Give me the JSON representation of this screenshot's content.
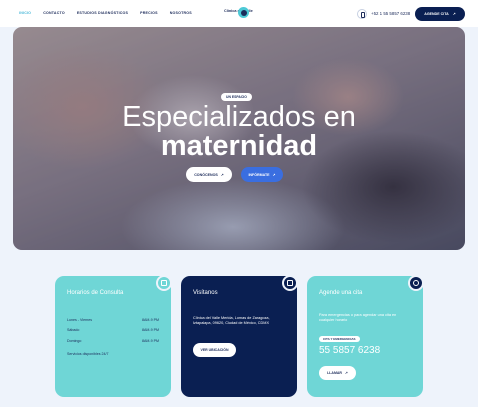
{
  "nav": {
    "links": [
      "INICIO",
      "CONTACTO",
      "ESTUDIOS DIAGNÓSTICOS",
      "PRECIOS",
      "NOSOTROS"
    ],
    "logo_text": "Clínica del Valle",
    "phone": "+52 1 55 5857 6238",
    "cta_label": "AGENDE CITA",
    "cta_icon": "arrow-up-right-icon"
  },
  "hero": {
    "badge": "UN ESPACIO",
    "title_line1": "Especializados en",
    "title_line2": "maternidad",
    "button_primary": "CONÓCENOS",
    "button_secondary": "INFÓRMATE",
    "button_icon": "arrow-up-right-icon"
  },
  "cards": {
    "schedule": {
      "title": "Horarios de Consulta",
      "icon": "calendar-icon",
      "rows": [
        {
          "day": "Lunes - Viernes",
          "hours": "8AM-9 PM"
        },
        {
          "day": "Sábado",
          "hours": "8AM-9 PM"
        },
        {
          "day": "Domingo",
          "hours": "8AM-9 PM"
        }
      ],
      "note": "Servicios disponibles 24/7"
    },
    "visit": {
      "title": "Visítanos",
      "icon": "map-icon",
      "address": "Clínica del Valle Merida, Lomas de Zaragoza, Iztapalapa, 09620, Ciudad de México, CDMX",
      "button": "VER UBICACIÓN"
    },
    "appointment": {
      "title": "Agende una cita",
      "icon": "user-icon",
      "text": "Para emergencias o para agendar una cita en cualquier horario",
      "pill": "CITA Y EMERGENCIAS",
      "phone": "55 5857 6238",
      "button": "LLAMAR"
    }
  }
}
